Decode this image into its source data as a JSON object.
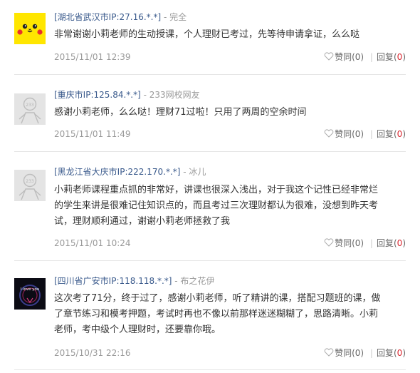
{
  "comments": [
    {
      "location": "[湖北省武汉市IP:27.16.*.*]",
      "separator": " - ",
      "user": "完全",
      "text": "非常谢谢小莉老师的生动授课，个人理财已考过，先等待申请拿证，么么哒",
      "time": "2015/11/01 12:39",
      "like_label": "赞同",
      "like_count": "(0)",
      "reply_label": "回复",
      "reply_open": "(",
      "reply_count": "0",
      "reply_close": ")",
      "avatar": "pikachu-avatar"
    },
    {
      "location": "[重庆市IP:125.84.*.*]",
      "separator": " - ",
      "user": "233网校网友",
      "text": "感谢小莉老师，么么哒！理财71过啦！只用了两周的空余时间",
      "time": "2015/11/01 11:49",
      "like_label": "赞同",
      "like_count": "(0)",
      "reply_label": "回复",
      "reply_open": "(",
      "reply_count": "0",
      "reply_close": ")",
      "avatar": "default-233-avatar"
    },
    {
      "location": "[黑龙江省大庆市IP:222.170.*.*]",
      "separator": " - ",
      "user": "冰儿",
      "text_lines": [
        "小莉老师课程重点抓的非常好，讲课也很深入浅出，对于我这个记性已经非常烂",
        "的学生来讲是很难记住知识点的，而且考过三次理财都认为很难，没想到昨天考",
        "试，理财顺利通过，谢谢小莉老师拯救了我"
      ],
      "time": "2015/11/01 10:24",
      "like_label": "赞同",
      "like_count": "(0)",
      "reply_label": "回复",
      "reply_open": "(",
      "reply_count": "0",
      "reply_close": ")",
      "avatar": "default-233-avatar"
    },
    {
      "location": "[四川省广安市IP:118.118.*.*]",
      "separator": " - ",
      "user": "布之花伊",
      "text_lines": [
        "这次考了71分，终于过了，感谢小莉老师，听了精讲的课，搭配习题班的课，做",
        "了章节练习和模考押题，考试时再也不像以前那样迷迷糊糊了，思路清晰。小莉",
        "老师，考中级个人理财时，还要靠你哦。"
      ],
      "time": "2015/10/31 22:16",
      "like_label": "赞同",
      "like_count": "(0)",
      "reply_label": "回复",
      "reply_open": "(",
      "reply_count": "0",
      "reply_close": ")",
      "avatar": "i-love-you-avatar",
      "avatar_text": "I love you"
    }
  ],
  "avatar_default_text": "233",
  "colors": {
    "location": "#3a5a8c",
    "muted": "#999999",
    "reply_count": "#d9262f",
    "divider": "#e5e5e5"
  }
}
